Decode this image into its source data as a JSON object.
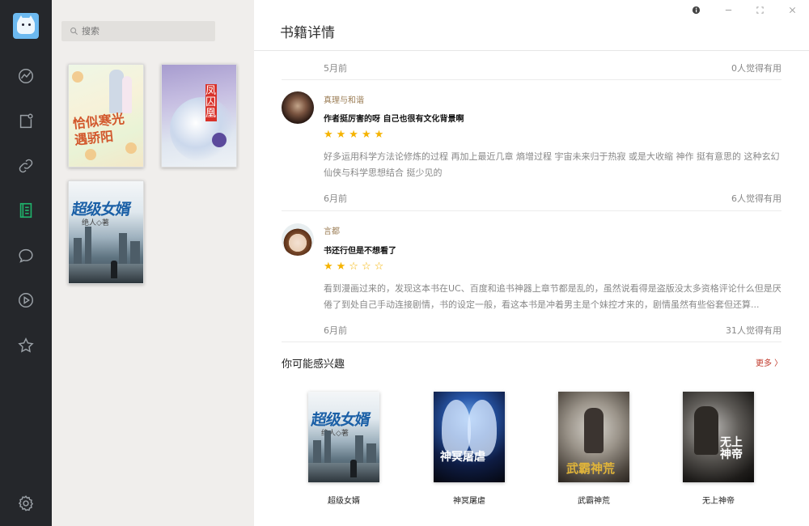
{
  "nav": {
    "items": [
      {
        "name": "discover"
      },
      {
        "name": "bookstore"
      },
      {
        "name": "links"
      },
      {
        "name": "bookshelf",
        "active": true
      },
      {
        "name": "comments"
      },
      {
        "name": "play"
      },
      {
        "name": "favorites"
      },
      {
        "name": "settings"
      }
    ],
    "accent": "#1fb26b"
  },
  "shelf": {
    "search_placeholder": "搜索",
    "books": [
      {
        "cover_title": "恰似寒光遇骄阳"
      },
      {
        "cover_title": "凤囚凰"
      },
      {
        "cover_title": "超级女婿",
        "cover_author": "绝人◇著"
      }
    ]
  },
  "main": {
    "title": "书籍详情",
    "window_controls": [
      "info",
      "minimize",
      "maximize",
      "close"
    ],
    "comments": [
      {
        "time": "5月前",
        "helpful": "0人觉得有用"
      },
      {
        "user": "真理与和谐",
        "title": "作者挺厉害的呀 自己也很有文化背景啊",
        "stars": "★★★★★",
        "body": "好多运用科学方法论修炼的过程 再加上最近几章 熵增过程 宇宙未来归于热寂 或是大收缩 神作 挺有意思的 这种玄幻仙侠与科学思想结合 挺少见的",
        "time": "6月前",
        "helpful": "6人觉得有用"
      },
      {
        "user": "言都",
        "title": "书还行但是不想看了",
        "stars": "★★☆☆☆",
        "body": "看到漫画过来的，发现这本书在UC、百度和追书神器上章节都是乱的，虽然说看得是盗版没太多资格评论什么但是厌倦了到处自己手动连接剧情，书的设定一般，看这本书是冲着男主是个妹控才来的，剧情虽然有些俗套但还算...",
        "time": "6月前",
        "helpful": "31人觉得有用"
      }
    ],
    "recommend": {
      "title": "你可能感兴趣",
      "more": "更多 〉",
      "books": [
        {
          "name": "超级女婿",
          "cover_title": "超级女婿",
          "cover_author": "绝人◇著"
        },
        {
          "name": "神冥屠虐",
          "cover_title": "神冥屠虐"
        },
        {
          "name": "武霸神荒",
          "cover_title": "武霸神荒"
        },
        {
          "name": "无上神帝",
          "cover_title": "无上神帝"
        }
      ]
    }
  }
}
